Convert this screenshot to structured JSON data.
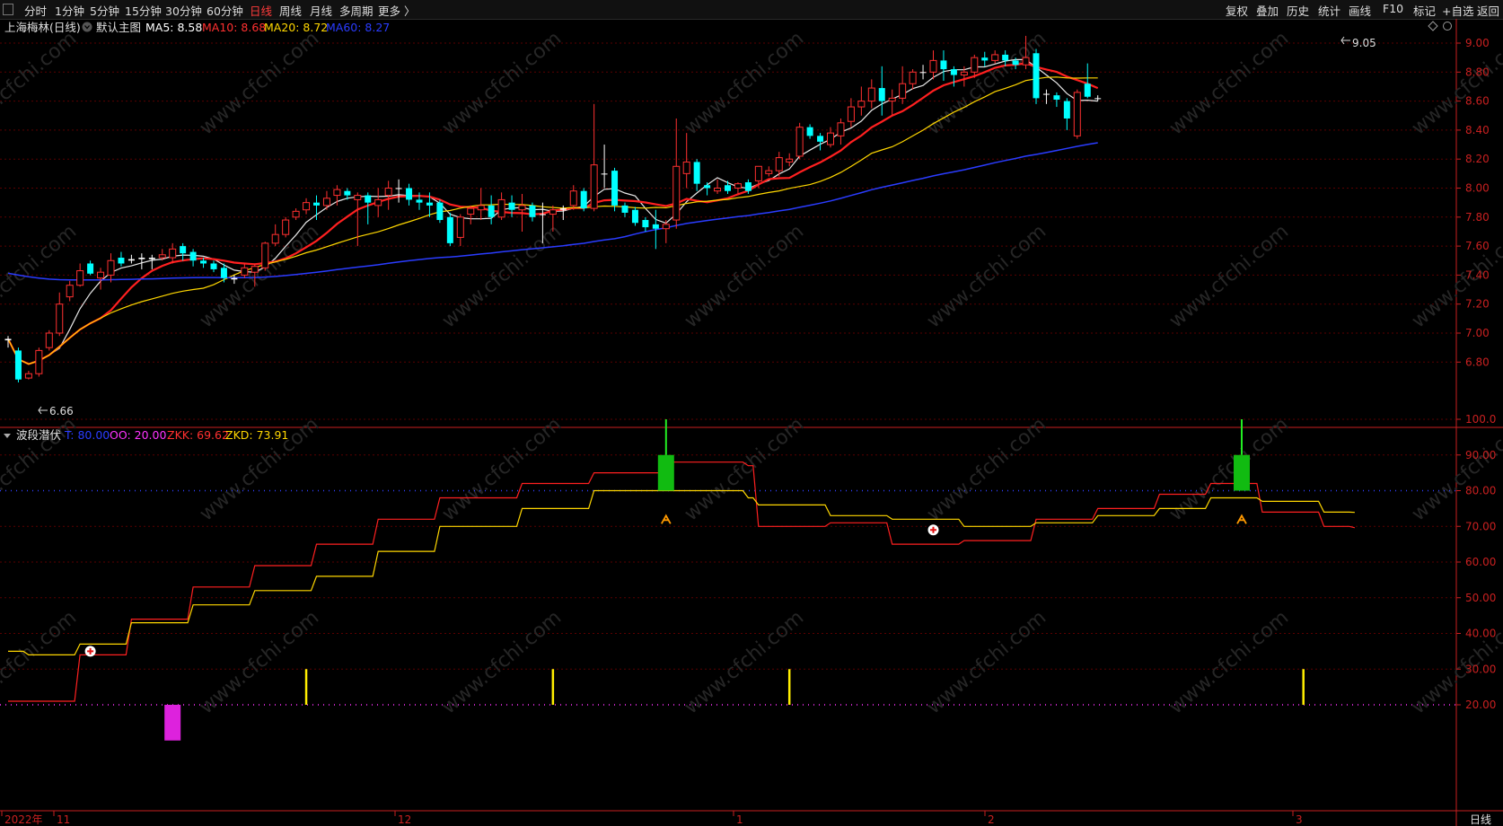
{
  "toolbar": {
    "left": [
      "分时",
      "1分钟",
      "5分钟",
      "15分钟",
      "30分钟",
      "60分钟",
      "日线",
      "周线",
      "月线",
      "多周期",
      "更多 〉"
    ],
    "active": "日线",
    "right": [
      "复权",
      "叠加",
      "历史",
      "统计",
      "画线",
      "F10",
      "标记",
      "+自选",
      "返回"
    ]
  },
  "main_header": {
    "stock": "上海梅林(日线)",
    "template": "默认主图",
    "ma": [
      {
        "label": "MA5: 8.58",
        "color": "#ffffff"
      },
      {
        "label": "MA10: 8.68",
        "color": "#ff3030"
      },
      {
        "label": "MA20: 8.72",
        "color": "#ffd700"
      },
      {
        "label": "MA60: 8.27",
        "color": "#2a3cff"
      }
    ]
  },
  "sub_header": {
    "name": "波段潜伏",
    "items": [
      {
        "label": "T: 80.00",
        "color": "#2a3cff"
      },
      {
        "label": "OO: 20.00",
        "color": "#ff33ff"
      },
      {
        "label": "ZKK: 69.62",
        "color": "#ff3030"
      },
      {
        "label": "ZKD: 73.91",
        "color": "#ffd700"
      }
    ]
  },
  "price_axis": [
    "9.00",
    "8.80",
    "8.60",
    "8.40",
    "8.20",
    "8.00",
    "7.80",
    "7.60",
    "7.40",
    "7.20",
    "7.00",
    "6.80"
  ],
  "osc_axis": [
    "100.0",
    "90.00",
    "80.00",
    "70.00",
    "60.00",
    "50.00",
    "40.00",
    "30.00",
    "20.00"
  ],
  "date_axis": [
    {
      "label": "2022年",
      "pos": 2
    },
    {
      "label": "11",
      "pos": 60
    },
    {
      "label": "12",
      "pos": 440
    },
    {
      "label": "1",
      "pos": 817
    },
    {
      "label": "2",
      "pos": 1097
    },
    {
      "label": "3",
      "pos": 1440
    }
  ],
  "period_label": "日线",
  "high_marker": "9.05",
  "low_marker": "6.66",
  "watermark": "www.cfchi.com",
  "colors": {
    "up": "#ff3030",
    "down": "#00ffff",
    "grid": "#5a0000",
    "axis": "#c82020",
    "bg": "#000000"
  },
  "chart_data": {
    "type": "candlestick",
    "candles": [
      [
        6.95,
        6.96,
        6.9,
        6.98
      ],
      [
        6.88,
        6.68,
        6.66,
        6.9
      ],
      [
        6.69,
        6.72,
        6.68,
        6.74
      ],
      [
        6.72,
        6.88,
        6.7,
        6.9
      ],
      [
        6.9,
        7.0,
        6.88,
        7.02
      ],
      [
        7.0,
        7.2,
        6.98,
        7.28
      ],
      [
        7.25,
        7.33,
        7.22,
        7.36
      ],
      [
        7.33,
        7.43,
        7.32,
        7.48
      ],
      [
        7.48,
        7.41,
        7.4,
        7.5
      ],
      [
        7.38,
        7.42,
        7.3,
        7.45
      ],
      [
        7.4,
        7.5,
        7.35,
        7.55
      ],
      [
        7.52,
        7.48,
        7.46,
        7.56
      ],
      [
        7.5,
        7.51,
        7.48,
        7.54
      ],
      [
        7.52,
        7.51,
        7.44,
        7.55
      ],
      [
        7.52,
        7.51,
        7.44,
        7.54
      ],
      [
        7.52,
        7.54,
        7.5,
        7.58
      ],
      [
        7.52,
        7.58,
        7.48,
        7.62
      ],
      [
        7.6,
        7.55,
        7.5,
        7.62
      ],
      [
        7.56,
        7.5,
        7.46,
        7.58
      ],
      [
        7.5,
        7.48,
        7.45,
        7.52
      ],
      [
        7.48,
        7.44,
        7.42,
        7.5
      ],
      [
        7.45,
        7.38,
        7.35,
        7.48
      ],
      [
        7.38,
        7.37,
        7.34,
        7.4
      ],
      [
        7.4,
        7.45,
        7.38,
        7.48
      ],
      [
        7.42,
        7.46,
        7.32,
        7.48
      ],
      [
        7.45,
        7.62,
        7.43,
        7.63
      ],
      [
        7.62,
        7.68,
        7.6,
        7.75
      ],
      [
        7.68,
        7.78,
        7.66,
        7.8
      ],
      [
        7.8,
        7.84,
        7.78,
        7.86
      ],
      [
        7.85,
        7.9,
        7.82,
        7.93
      ],
      [
        7.9,
        7.88,
        7.78,
        7.95
      ],
      [
        7.88,
        7.93,
        7.85,
        7.98
      ],
      [
        7.95,
        7.99,
        7.88,
        8.02
      ],
      [
        7.98,
        7.95,
        7.92,
        8.0
      ],
      [
        7.92,
        7.95,
        7.6,
        7.97
      ],
      [
        7.95,
        7.9,
        7.75,
        7.97
      ],
      [
        7.88,
        7.92,
        7.8,
        8.0
      ],
      [
        7.95,
        8.0,
        7.85,
        8.05
      ],
      [
        8.0,
        8.0,
        7.9,
        8.06
      ],
      [
        8.0,
        7.92,
        7.88,
        8.03
      ],
      [
        7.92,
        7.9,
        7.85,
        7.97
      ],
      [
        7.9,
        7.88,
        7.8,
        7.97
      ],
      [
        7.9,
        7.78,
        7.76,
        7.92
      ],
      [
        7.8,
        7.62,
        7.6,
        7.83
      ],
      [
        7.66,
        7.8,
        7.6,
        7.82
      ],
      [
        7.82,
        7.86,
        7.75,
        7.88
      ],
      [
        7.85,
        7.88,
        7.78,
        8.0
      ],
      [
        7.88,
        7.8,
        7.75,
        7.95
      ],
      [
        7.8,
        7.92,
        7.78,
        7.97
      ],
      [
        7.9,
        7.85,
        7.8,
        7.95
      ],
      [
        7.85,
        7.88,
        7.7,
        7.96
      ],
      [
        7.88,
        7.8,
        7.77,
        7.9
      ],
      [
        7.82,
        7.82,
        7.62,
        7.9
      ],
      [
        7.82,
        7.85,
        7.7,
        7.88
      ],
      [
        7.85,
        7.86,
        7.78,
        7.88
      ],
      [
        7.88,
        7.98,
        7.85,
        8.02
      ],
      [
        7.98,
        7.86,
        7.84,
        8.0
      ],
      [
        7.86,
        8.16,
        7.84,
        8.58
      ],
      [
        8.1,
        8.1,
        8.0,
        8.3
      ],
      [
        8.12,
        7.88,
        7.84,
        8.14
      ],
      [
        7.88,
        7.83,
        7.8,
        7.9
      ],
      [
        7.85,
        7.76,
        7.74,
        7.87
      ],
      [
        7.78,
        7.73,
        7.7,
        7.8
      ],
      [
        7.75,
        7.72,
        7.58,
        7.85
      ],
      [
        7.72,
        7.75,
        7.62,
        7.78
      ],
      [
        7.78,
        8.15,
        7.72,
        8.48
      ],
      [
        8.1,
        8.18,
        8.0,
        8.38
      ],
      [
        8.18,
        8.03,
        7.98,
        8.2
      ],
      [
        8.02,
        8.0,
        7.95,
        8.04
      ],
      [
        7.98,
        8.0,
        7.96,
        8.06
      ],
      [
        8.02,
        7.98,
        7.96,
        8.05
      ],
      [
        8.0,
        8.03,
        7.96,
        8.04
      ],
      [
        8.04,
        7.98,
        7.96,
        8.06
      ],
      [
        8.05,
        8.15,
        8.0,
        8.15
      ],
      [
        8.1,
        8.12,
        8.08,
        8.15
      ],
      [
        8.12,
        8.21,
        8.08,
        8.25
      ],
      [
        8.18,
        8.2,
        8.15,
        8.24
      ],
      [
        8.22,
        8.42,
        8.2,
        8.45
      ],
      [
        8.42,
        8.36,
        8.34,
        8.44
      ],
      [
        8.36,
        8.32,
        8.26,
        8.38
      ],
      [
        8.3,
        8.38,
        8.28,
        8.42
      ],
      [
        8.36,
        8.45,
        8.3,
        8.48
      ],
      [
        8.46,
        8.56,
        8.42,
        8.62
      ],
      [
        8.56,
        8.6,
        8.5,
        8.7
      ],
      [
        8.6,
        8.69,
        8.55,
        8.75
      ],
      [
        8.69,
        8.6,
        8.5,
        8.84
      ],
      [
        8.6,
        8.62,
        8.5,
        8.68
      ],
      [
        8.62,
        8.72,
        8.58,
        8.84
      ],
      [
        8.72,
        8.8,
        8.68,
        8.82
      ],
      [
        8.8,
        8.8,
        8.75,
        8.85
      ],
      [
        8.8,
        8.88,
        8.75,
        8.95
      ],
      [
        8.88,
        8.82,
        8.74,
        8.95
      ],
      [
        8.82,
        8.78,
        8.7,
        8.84
      ],
      [
        8.78,
        8.8,
        8.7,
        8.84
      ],
      [
        8.8,
        8.9,
        8.76,
        8.92
      ],
      [
        8.9,
        8.88,
        8.84,
        8.94
      ],
      [
        8.88,
        8.92,
        8.86,
        8.95
      ],
      [
        8.92,
        8.88,
        8.84,
        8.95
      ],
      [
        8.88,
        8.85,
        8.82,
        8.9
      ],
      [
        8.85,
        8.9,
        8.82,
        9.05
      ],
      [
        8.93,
        8.62,
        8.58,
        8.96
      ],
      [
        8.65,
        8.65,
        8.58,
        8.68
      ],
      [
        8.64,
        8.61,
        8.56,
        8.66
      ],
      [
        8.6,
        8.48,
        8.4,
        8.62
      ],
      [
        8.36,
        8.66,
        8.34,
        8.68
      ],
      [
        8.72,
        8.63,
        8.62,
        8.86
      ],
      [
        8.62,
        8.62,
        8.6,
        8.64
      ]
    ],
    "ma_period_labels": [
      "MA5",
      "MA10",
      "MA20",
      "MA60"
    ],
    "oscillator": {
      "T": 80,
      "OO": 20,
      "ZKK": [
        [
          0,
          21
        ],
        [
          2,
          21
        ],
        [
          7,
          34
        ],
        [
          12,
          44
        ],
        [
          18,
          53
        ],
        [
          24,
          59
        ],
        [
          30,
          65
        ],
        [
          36,
          72
        ],
        [
          42,
          78
        ],
        [
          50,
          82
        ],
        [
          57,
          85
        ],
        [
          64,
          88
        ],
        [
          72,
          87
        ],
        [
          73,
          70
        ],
        [
          80,
          71
        ],
        [
          86,
          65
        ],
        [
          93,
          66
        ],
        [
          100,
          72
        ],
        [
          106,
          75
        ],
        [
          112,
          79
        ],
        [
          117,
          82
        ],
        [
          122,
          74
        ],
        [
          128,
          70
        ],
        [
          131,
          69.62
        ]
      ],
      "ZKD": [
        [
          0,
          35
        ],
        [
          2,
          34
        ],
        [
          7,
          37
        ],
        [
          12,
          43
        ],
        [
          18,
          48
        ],
        [
          24,
          52
        ],
        [
          30,
          56
        ],
        [
          36,
          63
        ],
        [
          42,
          70
        ],
        [
          50,
          75
        ],
        [
          57,
          80
        ],
        [
          64,
          80
        ],
        [
          72,
          78
        ],
        [
          73,
          76
        ],
        [
          80,
          73
        ],
        [
          86,
          72
        ],
        [
          93,
          70
        ],
        [
          100,
          71
        ],
        [
          106,
          73
        ],
        [
          112,
          75
        ],
        [
          117,
          78
        ],
        [
          122,
          77
        ],
        [
          128,
          74
        ],
        [
          131,
          73.91
        ]
      ],
      "green_bars": [
        64,
        120
      ],
      "yellow_spikes": [
        29,
        53,
        76,
        126
      ],
      "magenta_bar": [
        16,
        20,
        10
      ],
      "buy_markers": [
        [
          8,
          35
        ],
        [
          90,
          69
        ]
      ],
      "sell_markers": [
        [
          64,
          72
        ],
        [
          120,
          72
        ]
      ]
    }
  }
}
